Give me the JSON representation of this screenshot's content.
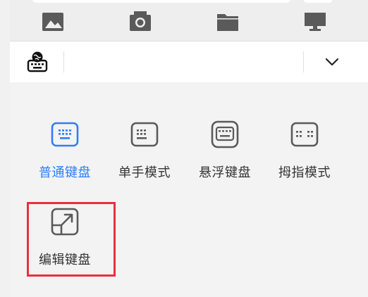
{
  "top_icons": [
    {
      "name": "image-icon"
    },
    {
      "name": "camera-icon"
    },
    {
      "name": "folder-icon"
    },
    {
      "name": "monitor-icon"
    }
  ],
  "toolbar": {
    "left_icon": "keyboard-language-icon",
    "right_icon": "chevron-down-icon"
  },
  "modes": [
    {
      "label": "普通键盘",
      "icon": "keyboard-standard-icon",
      "active": true
    },
    {
      "label": "单手模式",
      "icon": "keyboard-one-hand-icon",
      "active": false
    },
    {
      "label": "悬浮键盘",
      "icon": "keyboard-floating-icon",
      "active": false
    },
    {
      "label": "拇指模式",
      "icon": "keyboard-thumb-icon",
      "active": false
    },
    {
      "label": "编辑键盘",
      "icon": "edit-keyboard-icon",
      "active": false
    }
  ],
  "colors": {
    "accent": "#2f7ef5",
    "icon_gray": "#5a5a5a",
    "highlight": "#e8303a"
  }
}
